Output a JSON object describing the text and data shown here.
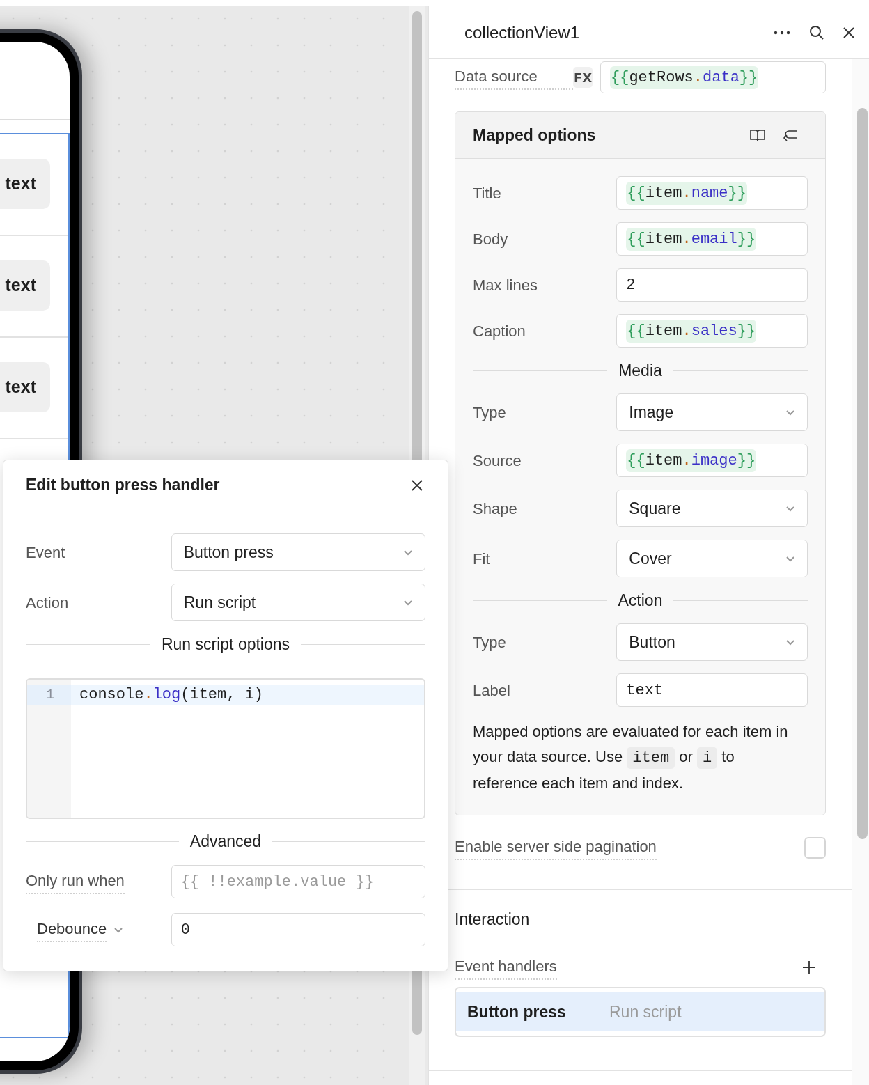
{
  "canvas": {
    "phone": {
      "buttons": [
        {
          "label": "text"
        },
        {
          "label": "text"
        },
        {
          "label": "text"
        }
      ]
    }
  },
  "handler_dialog": {
    "title": "Edit button press handler",
    "fields": [
      {
        "kind": "select",
        "label": "Event",
        "value": "Button press"
      },
      {
        "kind": "select",
        "label": "Action",
        "value": "Run script"
      }
    ],
    "options_heading": "Run script options",
    "code_lines": [
      {
        "number": "1",
        "code": "console.log(item, i)",
        "active": true
      }
    ],
    "advanced_heading": "Advanced",
    "advanced_fields": [
      {
        "kind": "input",
        "label": "Only run when",
        "placeholder": "{{ !!example.value }}"
      },
      {
        "kind": "menu_label",
        "label": "Debounce",
        "value": "0"
      }
    ]
  },
  "inspector": {
    "title": "collectionView1",
    "data_source": {
      "label": "Data source",
      "badge": "FX",
      "value": "{{getRows.data}}"
    },
    "mapped_options": {
      "title": "Mapped options",
      "rows": [
        {
          "kind": "input",
          "label": "Title",
          "value": "{{item.name}}"
        },
        {
          "kind": "input",
          "label": "Body",
          "value": "{{item.email}}"
        },
        {
          "kind": "input",
          "label": "Max lines",
          "value": "2"
        },
        {
          "kind": "input",
          "label": "Caption",
          "value": "{{item.sales}}"
        },
        {
          "kind": "heading",
          "label": "Media"
        },
        {
          "kind": "select",
          "label": "Type",
          "value": "Image"
        },
        {
          "kind": "input",
          "label": "Source",
          "value": "{{item.image}}"
        },
        {
          "kind": "select",
          "label": "Shape",
          "value": "Square"
        },
        {
          "kind": "select",
          "label": "Fit",
          "value": "Cover"
        },
        {
          "kind": "heading",
          "label": "Action"
        },
        {
          "kind": "select",
          "label": "Type",
          "value": "Button"
        },
        {
          "kind": "input",
          "label": "Label",
          "value": "text"
        }
      ],
      "description": [
        {
          "text": "Mapped options are evaluated for each item in your data source. Use ",
          "code": false
        },
        {
          "text": "item",
          "code": true
        },
        {
          "text": " or ",
          "code": false
        },
        {
          "text": "i",
          "code": true
        },
        {
          "text": " to reference each item and index.",
          "code": false
        }
      ]
    },
    "pagination": {
      "label": "Enable server side pagination",
      "checked": false
    },
    "interaction": {
      "title": "Interaction",
      "handlers_label": "Event handlers",
      "handlers": [
        {
          "event": "Button press",
          "action": "Run script",
          "selected": true
        }
      ]
    }
  }
}
